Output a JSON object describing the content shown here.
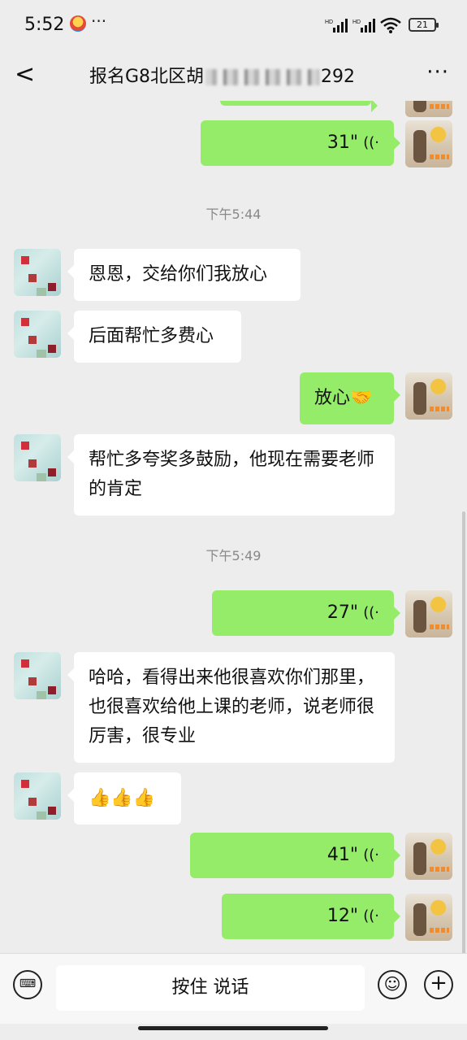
{
  "status": {
    "time": "5:52",
    "more": "···",
    "battery": "21",
    "net1": "HD",
    "net2": "HD"
  },
  "nav": {
    "back": "<",
    "title_prefix": "报名G8北区胡",
    "title_suffix": "292",
    "more": "···"
  },
  "messages": [
    {
      "side": "right",
      "type": "voice",
      "duration": "31\""
    },
    {
      "side": "time",
      "text": "下午5:44"
    },
    {
      "side": "left",
      "type": "text",
      "text": "恩恩，交给你们我放心"
    },
    {
      "side": "left",
      "type": "text",
      "text": "后面帮忙多费心"
    },
    {
      "side": "right",
      "type": "text",
      "text": "放心🤝"
    },
    {
      "side": "left",
      "type": "text",
      "text": "帮忙多夸奖多鼓励，他现在需要老师的肯定"
    },
    {
      "side": "time",
      "text": "下午5:49"
    },
    {
      "side": "right",
      "type": "voice",
      "duration": "27\""
    },
    {
      "side": "left",
      "type": "text",
      "text": "哈哈，看得出来他很喜欢你们那里，也很喜欢给他上课的老师，说老师很厉害，很专业"
    },
    {
      "side": "left",
      "type": "text",
      "text": "👍👍👍"
    },
    {
      "side": "right",
      "type": "voice",
      "duration": "41\""
    },
    {
      "side": "right",
      "type": "voice",
      "duration": "12\""
    }
  ],
  "input": {
    "talk_label": "按住 说话",
    "keyboard_icon": "keyboard-icon",
    "emoji_icon": "emoji-icon",
    "plus_icon": "plus-icon"
  },
  "colors": {
    "background": "#ededed",
    "outgoing_bubble": "#95ec69",
    "incoming_bubble": "#ffffff"
  }
}
